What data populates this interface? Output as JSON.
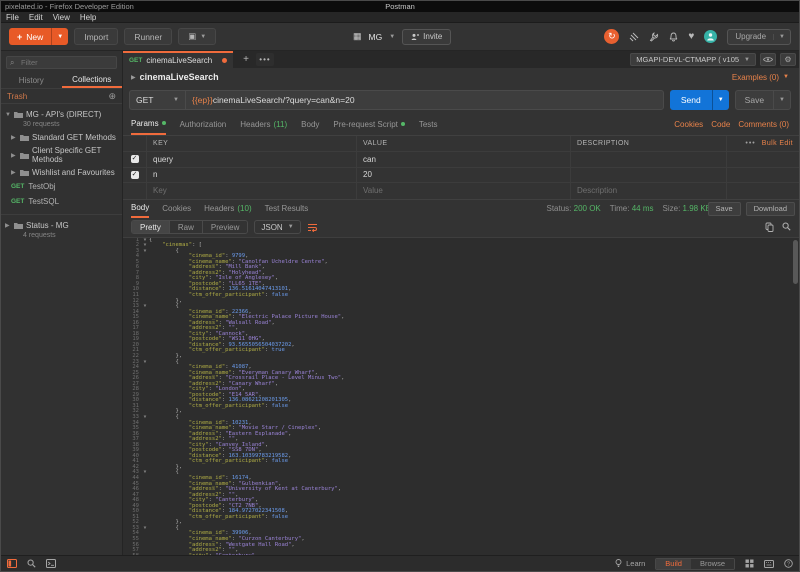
{
  "window": {
    "title": "pixelated.io - Firefox Developer Edition",
    "app_title": "Postman",
    "menus": [
      "File",
      "Edit",
      "View",
      "Help"
    ]
  },
  "header": {
    "new_label": "New",
    "import_label": "Import",
    "runner_label": "Runner",
    "workspace_name": "MG",
    "invite_label": "Invite",
    "upgrade_label": "Upgrade"
  },
  "sidebar": {
    "filter_placeholder": "Filter",
    "tabs": {
      "history": "History",
      "collections": "Collections"
    },
    "trash_label": "Trash",
    "collection": {
      "name": "MG - API's (DIRECT)",
      "meta": "30 requests"
    },
    "folders": [
      "Standard GET Methods",
      "Client Specific GET Methods",
      "Wishlist and Favourites"
    ],
    "requests": [
      {
        "method": "GET",
        "name": "TestObj"
      },
      {
        "method": "GET",
        "name": "TestSQL"
      }
    ],
    "status_collection": {
      "name": "Status - MG",
      "meta": "4 requests"
    }
  },
  "tabbar": {
    "tab": {
      "method": "GET",
      "name": "cinemaLiveSearch"
    },
    "environment": "MGAPI-DEVL-CTMAPP ( v105"
  },
  "request": {
    "name": "cinemaLiveSearch",
    "examples_label": "Examples (0)",
    "method": "GET",
    "url_variable": "{{ep}}",
    "url_path": "cinemaLiveSearch/?query=can&n=20",
    "send_label": "Send",
    "save_label": "Save",
    "tabs": [
      {
        "label": "Params"
      },
      {
        "label": "Authorization"
      },
      {
        "label": "Headers",
        "count": "(11)"
      },
      {
        "label": "Body"
      },
      {
        "label": "Pre-request Script"
      },
      {
        "label": "Tests"
      }
    ],
    "links": [
      "Cookies",
      "Code",
      "Comments (0)"
    ],
    "params": {
      "columns": [
        "KEY",
        "VALUE",
        "DESCRIPTION"
      ],
      "bulk_edit_label": "Bulk Edit",
      "rows": [
        {
          "key": "query",
          "value": "can"
        },
        {
          "key": "n",
          "value": "20"
        }
      ],
      "placeholder_row": {
        "key": "Key",
        "value": "Value",
        "description": "Description"
      }
    }
  },
  "response": {
    "tabs": [
      {
        "label": "Body"
      },
      {
        "label": "Cookies"
      },
      {
        "label": "Headers",
        "count": "(10)"
      },
      {
        "label": "Test Results"
      }
    ],
    "status": {
      "label": "Status:",
      "value": "200 OK"
    },
    "time": {
      "label": "Time:",
      "value": "44 ms"
    },
    "size": {
      "label": "Size:",
      "value": "1.98 KB"
    },
    "save_label": "Save",
    "download_label": "Download",
    "view_modes": [
      "Pretty",
      "Raw",
      "Preview"
    ],
    "format": "JSON",
    "body": {
      "cinemas": [
        {
          "cinema_id": 9799,
          "cinema_name": "Canolfan Ucheldre Centre",
          "address": "Mill Bank",
          "address2": "Holyhead",
          "city": "Isle of Anglesey",
          "postcode": "LL65 1TE",
          "distance": "136.51614047413101",
          "ctm_offer_participant": false
        },
        {
          "cinema_id": 22366,
          "cinema_name": "Electric Palace Picture House",
          "address": "Walsall Road",
          "address2": "",
          "city": "Cannock",
          "postcode": "WS11 0HG",
          "distance": "93.5655056504037202",
          "ctm_offer_participant": true
        },
        {
          "cinema_id": 41087,
          "cinema_name": "Everyman Canary Wharf",
          "address": "Crossrail Place - Level Minus Two",
          "address2": "Canary Wharf",
          "city": "London",
          "postcode": "E14 5AR",
          "distance": "136.08621208201305",
          "ctm_offer_participant": false
        },
        {
          "cinema_id": 10231,
          "cinema_name": "Movie Starr / Cineplex",
          "address": "Eastern Esplanade",
          "address2": "",
          "city": "Canvey Island",
          "postcode": "SS8 7DN",
          "distance": "163.10399783219582",
          "ctm_offer_participant": false
        },
        {
          "cinema_id": 16174,
          "cinema_name": "Gulbenkian",
          "address": "University of Kent at Canterbury",
          "address2": "",
          "city": "Canterbury",
          "postcode": "CT2 7NB",
          "distance": "184.9727022341508",
          "ctm_offer_participant": false
        },
        {
          "cinema_id": 39906,
          "cinema_name": "Curzon Canterbury",
          "address": "Westgate Hall Road",
          "address2": "",
          "city": "Canterbury"
        }
      ]
    }
  },
  "status_bar": {
    "learn_label": "Learn",
    "build_label": "Build",
    "browse_label": "Browse"
  },
  "colors": {
    "accent_orange": "#f06b3c",
    "send_blue": "#1274d8",
    "green": "#55b767",
    "code_key": "#b0ad45",
    "code_string": "#9b84d8",
    "code_number": "#6b9ced"
  }
}
